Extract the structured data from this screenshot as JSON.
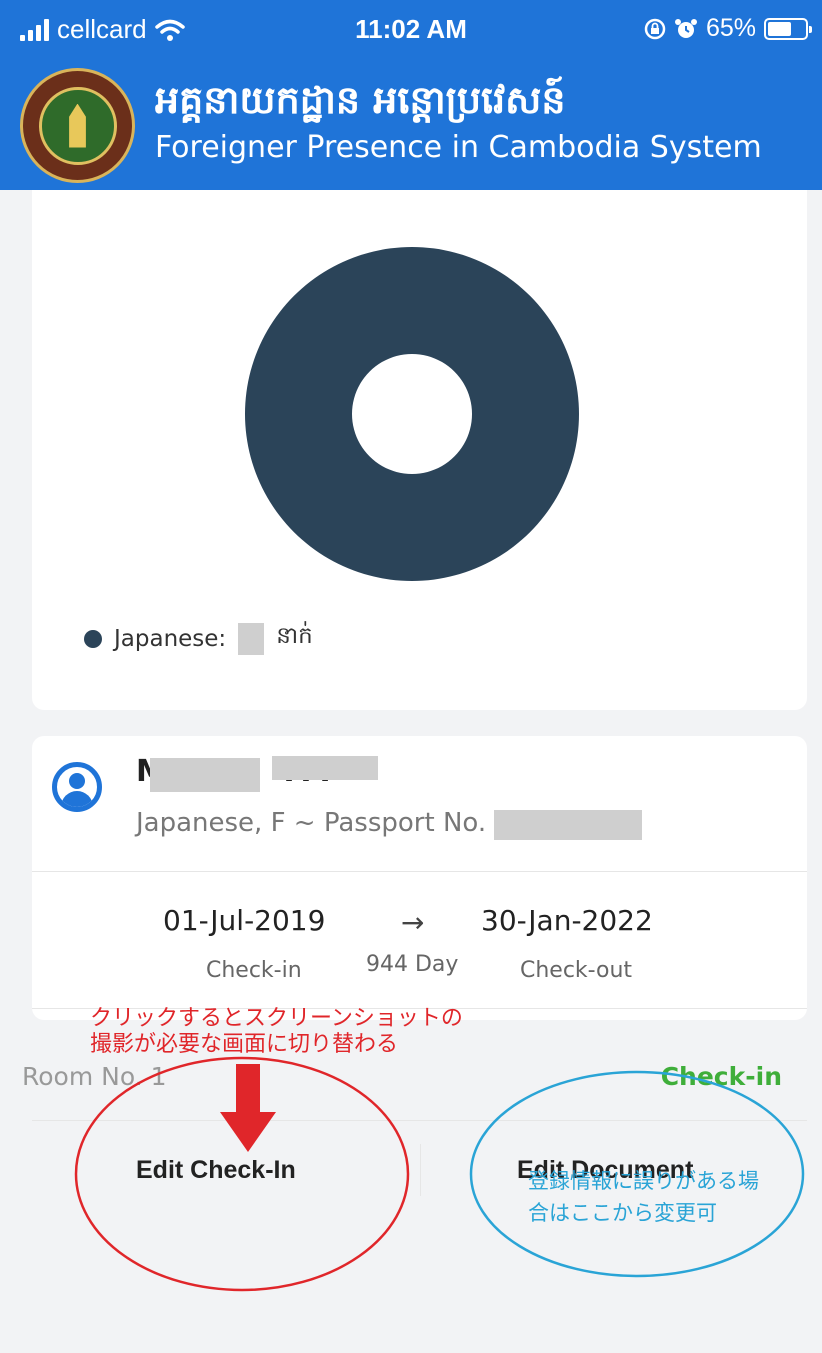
{
  "status_bar": {
    "carrier": "cellcard",
    "time": "11:02 AM",
    "battery": "65%",
    "battery_level": 0.65,
    "icons": [
      "signal-icon",
      "wifi-icon",
      "rotation-lock-icon",
      "alarm-icon",
      "battery-icon"
    ]
  },
  "header": {
    "title_khmer": "អគ្គនាយកដ្ឋាន អន្តោប្រវេសន៍",
    "title_en": "Foreigner Presence in Cambodia System",
    "logo_icon": "department-seal-icon"
  },
  "chart": {
    "type": "donut",
    "legend_label": "Japanese:",
    "legend_unit": "នាក់",
    "color": "#2b4459"
  },
  "chart_data": {
    "type": "pie",
    "categories": [
      "Japanese"
    ],
    "values": [
      1
    ],
    "colors": [
      "#2b4459"
    ],
    "legend": "bottom-left"
  },
  "guest": {
    "name": "M",
    "name_suffix": "A I",
    "subtitle": "Japanese, F ~ Passport No.  TR",
    "checkin_date": "01-Jul-2019",
    "checkout_date": "30-Jan-2022",
    "arrow": "→",
    "duration": "944 Day",
    "checkin_label": "Check-in",
    "checkout_label": "Check-out",
    "room": "Room No.  1",
    "status": "Check-in",
    "edit_checkin": "Edit Check-In",
    "edit_document": "Edit Document"
  },
  "annotations": {
    "red_line1": "クリックするとスクリーンショットの",
    "red_line2": "撮影が必要な画面に切り替わる",
    "blue_line1": "登録情報に誤りがある場",
    "blue_line2": "合はここから変更可",
    "red_color": "#e0262a",
    "blue_color": "#2aa4d6"
  }
}
